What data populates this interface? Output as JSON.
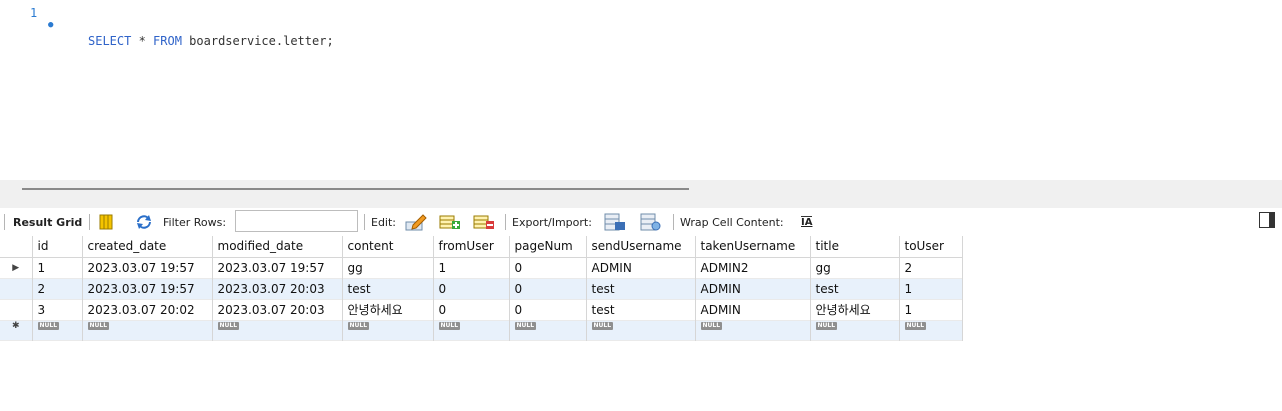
{
  "editor": {
    "line_number": "1",
    "fold_glyph": "●",
    "code_kw1": "SELECT",
    "code_mid": " * ",
    "code_kw2": "FROM",
    "code_rest": " boardservice.letter;"
  },
  "toolbar": {
    "result_grid_label": "Result Grid",
    "filter_rows_label": "Filter Rows:",
    "filter_rows_value": "",
    "edit_label": "Edit:",
    "export_import_label": "Export/Import:",
    "wrap_label": "Wrap Cell Content:",
    "wrap_icon_glyph": "IA"
  },
  "grid": {
    "columns": [
      "id",
      "created_date",
      "modified_date",
      "content",
      "fromUser",
      "pageNum",
      "sendUsername",
      "takenUsername",
      "title",
      "toUser"
    ],
    "rows": [
      [
        "1",
        "2023.03.07 19:57",
        "2023.03.07 19:57",
        "gg",
        "1",
        "0",
        "ADMIN",
        "ADMIN2",
        "gg",
        "2"
      ],
      [
        "2",
        "2023.03.07 19:57",
        "2023.03.07 20:03",
        "test",
        "0",
        "0",
        "test",
        "ADMIN",
        "test",
        "1"
      ],
      [
        "3",
        "2023.03.07 20:02",
        "2023.03.07 20:03",
        "안녕하세요",
        "0",
        "0",
        "test",
        "ADMIN",
        "안녕하세요",
        "1"
      ]
    ],
    "current_row_marker": "▶",
    "new_row_marker": "✱",
    "null_label": "NULL"
  },
  "colors": {
    "row_alt": "#e8f1fb",
    "keyword": "#2f63c9",
    "line_number": "#2b7bd1"
  }
}
